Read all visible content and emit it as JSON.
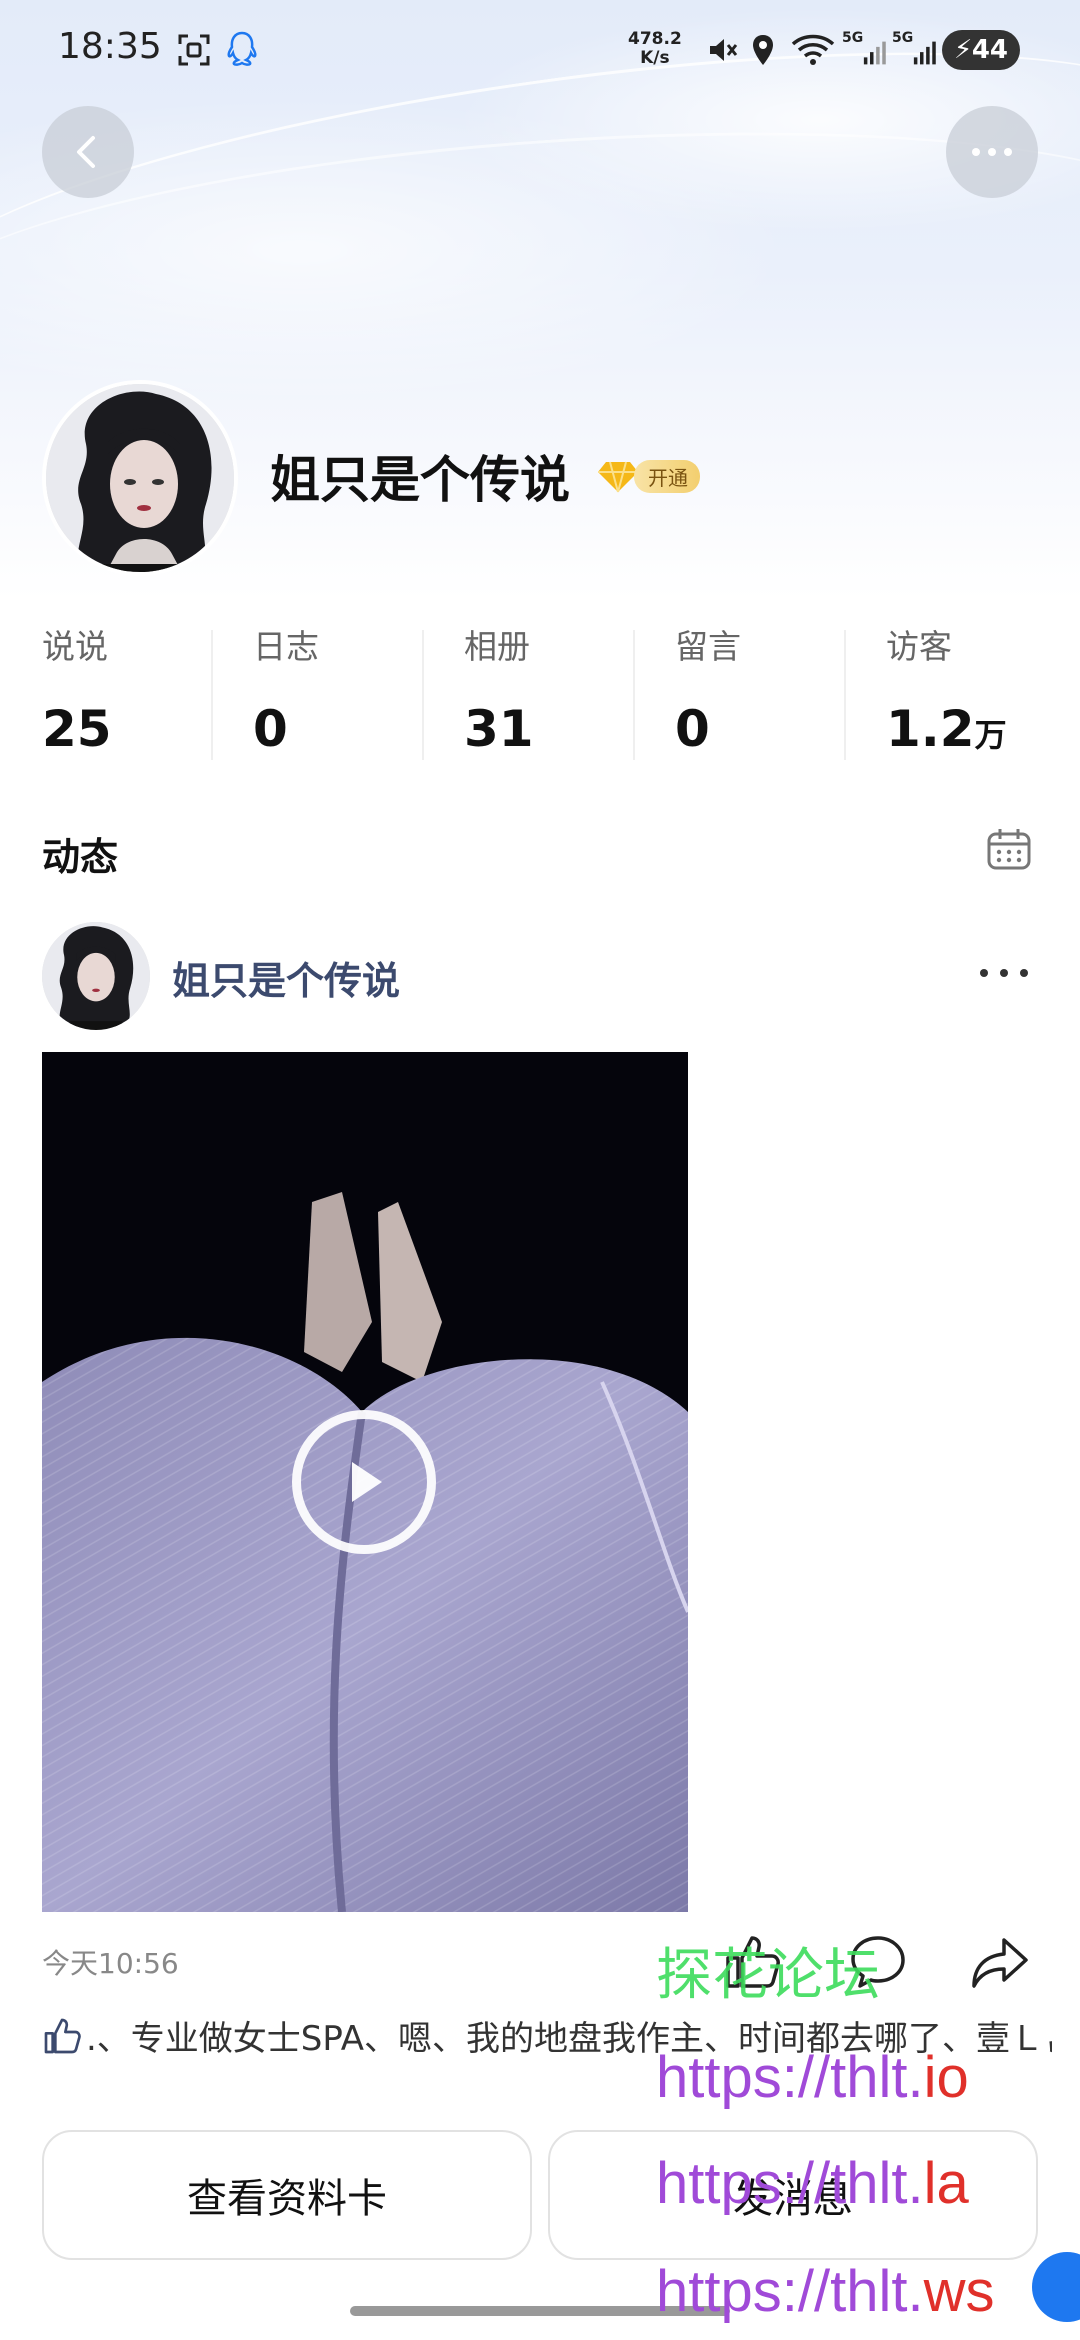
{
  "status_bar": {
    "time": "18:35",
    "network_speed_value": "478.2",
    "network_speed_unit": "K/s",
    "signal_1": "5G",
    "signal_2": "5G",
    "battery": "44"
  },
  "profile": {
    "nickname": "姐只是个传说",
    "vip_label": "开通"
  },
  "stats": [
    {
      "label": "说说",
      "value": "25",
      "unit": ""
    },
    {
      "label": "日志",
      "value": "0",
      "unit": ""
    },
    {
      "label": "相册",
      "value": "31",
      "unit": ""
    },
    {
      "label": "留言",
      "value": "0",
      "unit": ""
    },
    {
      "label": "访客",
      "value": "1.2",
      "unit": "万"
    }
  ],
  "section": {
    "title": "动态"
  },
  "post": {
    "author": "姐只是个传说",
    "time": "今天10:56",
    "text": ".、专业做女士SPA、嗯、我的地盘我作主、时间都去哪了、壹Ｌ〆山菜了"
  },
  "buttons": {
    "view_card": "查看资料卡",
    "send_message": "发消息"
  },
  "watermark": {
    "line1": "探花论坛",
    "line2_prefix": "https://thlt.",
    "line2_suffix": "io",
    "line3_prefix": "https://thlt.",
    "line3_suffix": "la",
    "line4_prefix": "https://thlt.",
    "line4_suffix": "ws"
  },
  "colors": {
    "author_blue": "#3c4a6e",
    "watermark_green": "#3ddc5b",
    "watermark_purple": "#a04ad8",
    "watermark_red": "#e0302a"
  }
}
